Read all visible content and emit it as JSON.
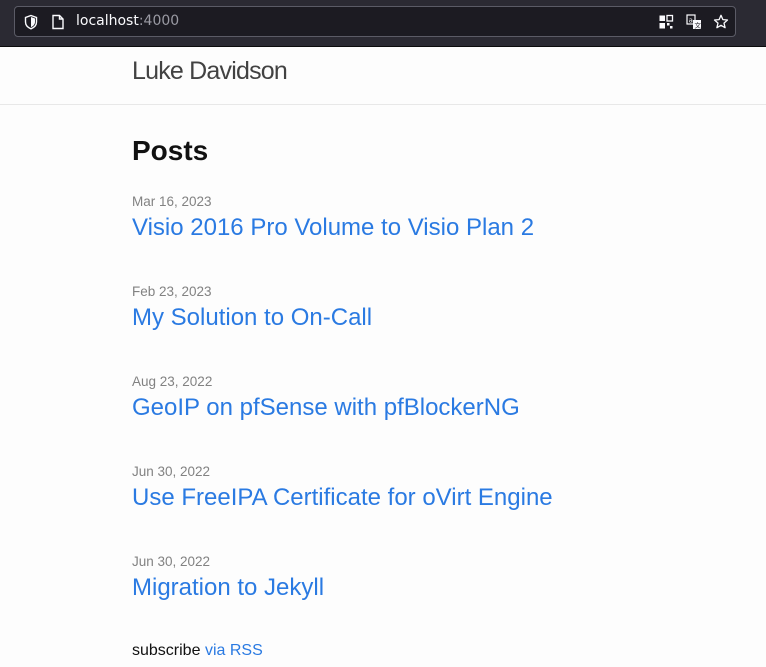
{
  "browser": {
    "url_host": "localhost",
    "url_port": ":4000",
    "icons": [
      "shield-icon",
      "page-icon",
      "qr-code-icon",
      "translate-icon",
      "bookmark-star-icon"
    ]
  },
  "site": {
    "title": "Luke Davidson"
  },
  "main": {
    "heading": "Posts",
    "posts": [
      {
        "date": "Mar 16, 2023",
        "title": "Visio 2016 Pro Volume to Visio Plan 2"
      },
      {
        "date": "Feb 23, 2023",
        "title": "My Solution to On-Call"
      },
      {
        "date": "Aug 23, 2022",
        "title": "GeoIP on pfSense with pfBlockerNG"
      },
      {
        "date": "Jun 30, 2022",
        "title": "Use FreeIPA Certificate for oVirt Engine"
      },
      {
        "date": "Jun 30, 2022",
        "title": "Migration to Jekyll"
      }
    ],
    "subscribe_prefix": "subscribe",
    "subscribe_link": "via RSS"
  },
  "colors": {
    "link": "#2a7ae2",
    "date": "#828282",
    "chrome": "#2b2a33"
  }
}
